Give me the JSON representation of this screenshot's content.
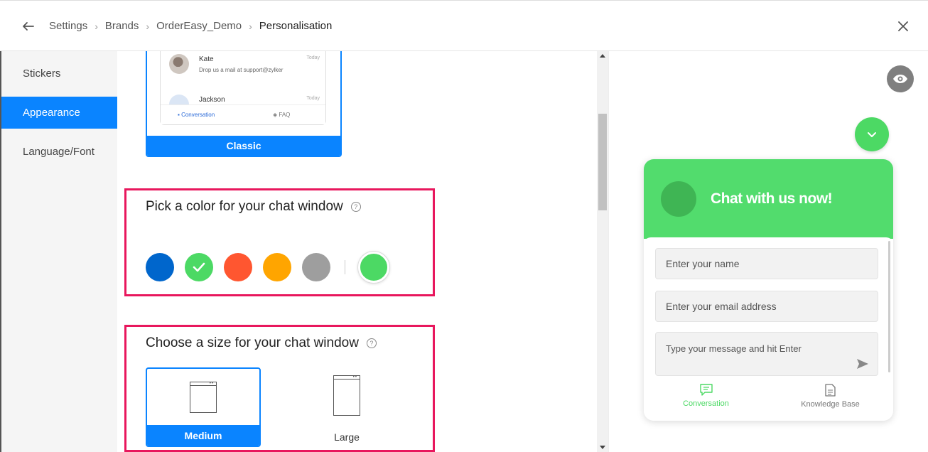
{
  "header": {
    "breadcrumbs": [
      "Settings",
      "Brands",
      "OrderEasy_Demo",
      "Personalisation"
    ]
  },
  "sidebar": {
    "items": [
      {
        "label": "Stickers",
        "active": false
      },
      {
        "label": "Appearance",
        "active": true
      },
      {
        "label": "Language/Font",
        "active": false
      }
    ]
  },
  "theme_preview": {
    "messages": [
      {
        "name": "Kate",
        "text": "Drop us a mail at support@zylker",
        "time": "Today"
      },
      {
        "name": "Jackson",
        "text": "",
        "time": "Today"
      }
    ],
    "tabs": [
      "Conversation",
      "FAQ"
    ],
    "label": "Classic"
  },
  "color_section": {
    "title": "Pick a color for your chat window",
    "swatches": [
      "#0066cc",
      "#4cd964",
      "#ff5630",
      "#ffa500",
      "#9e9e9e"
    ],
    "selected": "#4cd964",
    "custom_color": "#4cd964"
  },
  "size_section": {
    "title": "Choose a size for your chat window",
    "options": [
      "Medium",
      "Large"
    ],
    "selected": "Medium"
  },
  "widget": {
    "title": "Chat with us now!",
    "name_placeholder": "Enter your name",
    "email_placeholder": "Enter your email address",
    "message_placeholder": "Type your message and hit Enter",
    "tabs": [
      "Conversation",
      "Knowledge Base"
    ],
    "accent_color": "#52dc6d"
  },
  "icons": {
    "back": "arrow-left-icon",
    "close": "close-icon",
    "help": "question-circle-icon",
    "preview": "eye-icon",
    "minimize": "chevron-down-icon",
    "send": "send-icon",
    "conversation": "chat-icon",
    "knowledge_base": "document-icon"
  }
}
